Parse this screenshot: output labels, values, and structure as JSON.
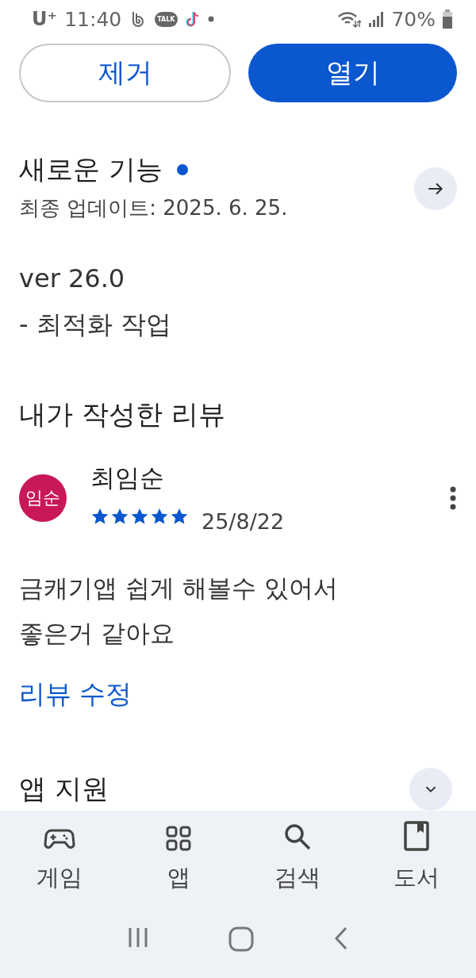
{
  "status_bar": {
    "carrier": "U⁺",
    "time": "11:40",
    "talk_label": "TALK",
    "battery": "70%"
  },
  "actions": [
    {
      "label": "제거",
      "kind": "outline"
    },
    {
      "label": "열기",
      "kind": "filled"
    }
  ],
  "whats_new": {
    "title": "새로운 기능",
    "new_dot": true,
    "updated": "최종 업데이트: 2025. 6. 25.",
    "notes": [
      "ver 26.0",
      "- 최적화 작업"
    ]
  },
  "my_review": {
    "title": "내가 작성한 리뷰",
    "avatar": "임순",
    "author": "최임순",
    "stars": 5,
    "date": "25/8/22",
    "text": "금캐기앱 쉽게 해볼수 있어서 좋은거 같아요",
    "edit_link": "리뷰 수정"
  },
  "app_support": {
    "title": "앱 지원",
    "expanded": false
  },
  "bottom_nav": [
    {
      "label": "게임",
      "kind": "games",
      "selected": false
    },
    {
      "label": "앱",
      "kind": "apps",
      "selected": false
    },
    {
      "label": "검색",
      "kind": "search",
      "selected": false
    },
    {
      "label": "도서",
      "kind": "books",
      "selected": false
    }
  ]
}
